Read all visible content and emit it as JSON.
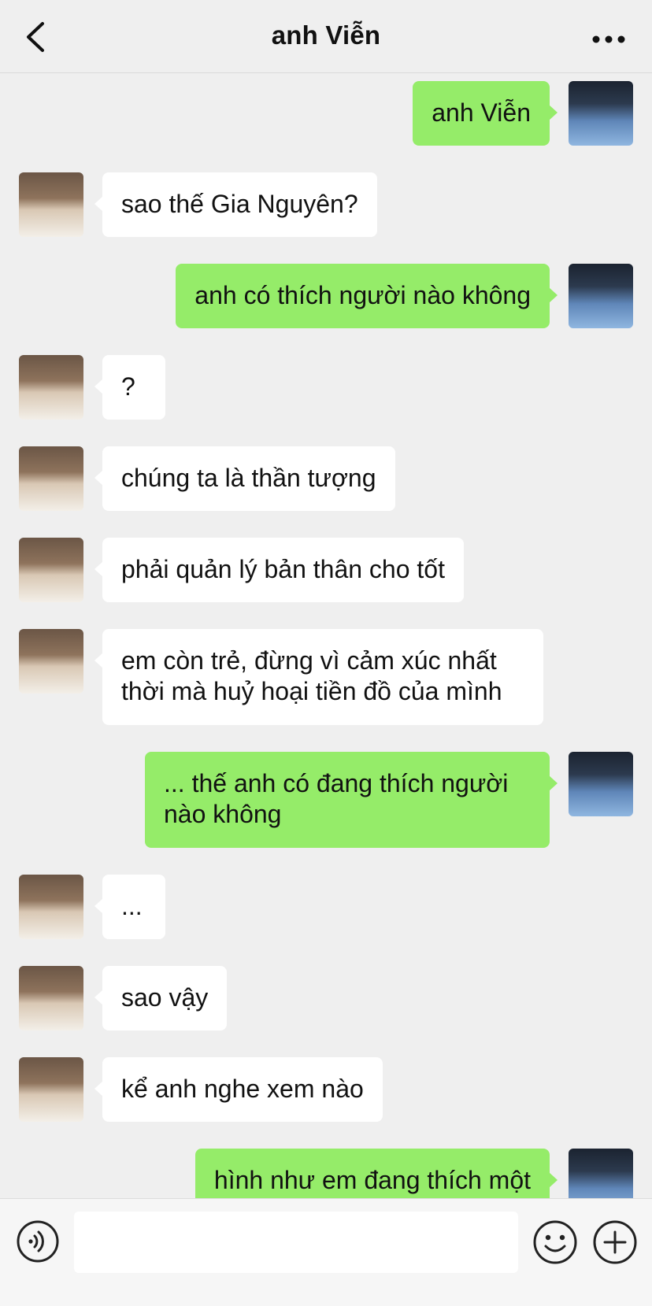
{
  "header": {
    "title": "anh Viễn"
  },
  "messages": [
    {
      "sender": "me",
      "text": "anh Viễn"
    },
    {
      "sender": "them",
      "text": "sao thế Gia Nguyên?"
    },
    {
      "sender": "me",
      "text": "anh có thích người nào không"
    },
    {
      "sender": "them",
      "text": "?"
    },
    {
      "sender": "them",
      "text": "chúng ta là thần tượng"
    },
    {
      "sender": "them",
      "text": "phải quản lý bản thân cho tốt"
    },
    {
      "sender": "them",
      "text": "em còn trẻ, đừng vì cảm xúc nhất thời mà huỷ hoại tiền đồ của mình"
    },
    {
      "sender": "me",
      "text": "... thế anh có đang thích người nào không"
    },
    {
      "sender": "them",
      "text": "..."
    },
    {
      "sender": "them",
      "text": "sao vậy"
    },
    {
      "sender": "them",
      "text": "kể anh nghe xem nào"
    },
    {
      "sender": "me",
      "text": "hình như em đang thích một"
    }
  ],
  "input": {
    "value": ""
  },
  "icons": {
    "back": "chevron-left-icon",
    "more": "more-dots-icon",
    "voice": "voice-icon",
    "emoji": "emoji-icon",
    "plus": "plus-icon"
  },
  "colors": {
    "background": "#efefef",
    "my_bubble": "#95ec69",
    "their_bubble": "#ffffff"
  }
}
